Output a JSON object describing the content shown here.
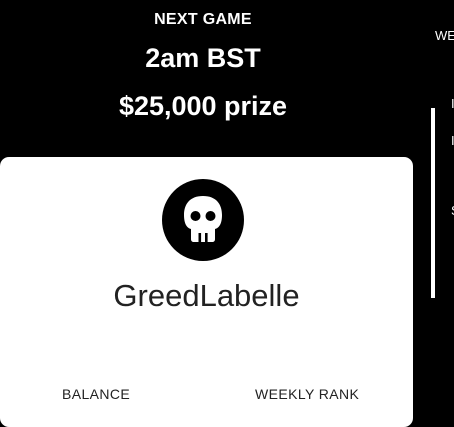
{
  "next_game": {
    "heading": "NEXT GAME",
    "time": "2am BST",
    "prize": "$25,000 prize"
  },
  "profile": {
    "avatar_icon": "skull-icon",
    "username": "GreedLabelle",
    "balance_label": "BALANCE",
    "weekly_rank_label": "WEEKLY RANK"
  },
  "side_card": {
    "top_text": "WE",
    "lines": [
      "I",
      "I",
      "S"
    ]
  },
  "colors": {
    "background": "#000000",
    "card": "#ffffff",
    "text_dark": "#222222"
  }
}
